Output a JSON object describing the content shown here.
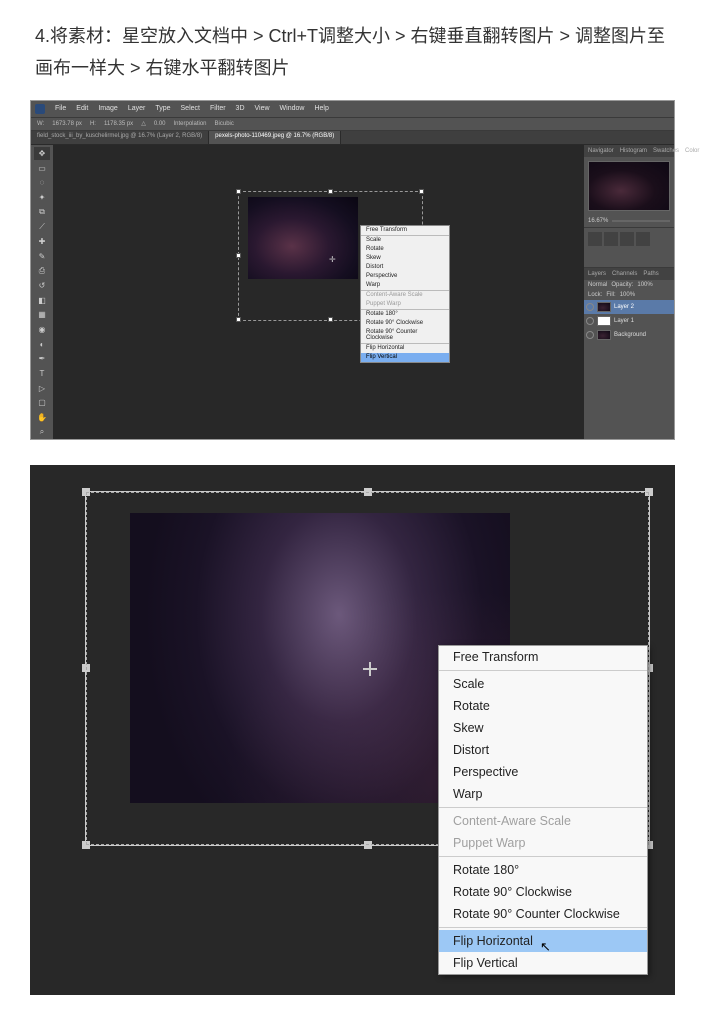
{
  "instruction_text": "4.将素材：星空放入文档中 > Ctrl+T调整大小 > 右键垂直翻转图片 > 调整图片至画布一样大 > 右键水平翻转图片",
  "menubar": [
    "File",
    "Edit",
    "Image",
    "Layer",
    "Type",
    "Select",
    "Filter",
    "3D",
    "View",
    "Window",
    "Help"
  ],
  "options_bar": {
    "w": "1673.78 px",
    "h": "1178.35 px",
    "angle": "0.00",
    "interp": "Interpolation",
    "bicubic": "Bicubic"
  },
  "doc_tabs": [
    "field_stock_iii_by_kuschelirmel.jpg @ 16.7% (Layer 2, RGB/8)",
    "pexels-photo-110469.jpeg @ 16.7% (RGB/8)"
  ],
  "active_tab_index": 1,
  "nav_panel": {
    "tabs": [
      "Navigator",
      "Histogram",
      "Swatches",
      "Color"
    ],
    "zoom": "16.67%"
  },
  "layers_panel": {
    "tabs": [
      "Layers",
      "Channels",
      "Paths"
    ],
    "mode": "Normal",
    "opacity": "100%",
    "fill": "100%",
    "lock": "Lock:",
    "layers": [
      {
        "name": "Layer 2",
        "thumb": "sky",
        "selected": true
      },
      {
        "name": "Layer 1",
        "thumb": "white",
        "selected": false
      },
      {
        "name": "Background",
        "thumb": "sky",
        "selected": false
      }
    ]
  },
  "context_menu_small": {
    "items": [
      {
        "t": "Free Transform",
        "e": true
      },
      {
        "hr": true
      },
      {
        "t": "Scale",
        "e": true
      },
      {
        "t": "Rotate",
        "e": true
      },
      {
        "t": "Skew",
        "e": true
      },
      {
        "t": "Distort",
        "e": true
      },
      {
        "t": "Perspective",
        "e": true
      },
      {
        "t": "Warp",
        "e": true
      },
      {
        "hr": true
      },
      {
        "t": "Content-Aware Scale",
        "e": false
      },
      {
        "t": "Puppet Warp",
        "e": false
      },
      {
        "hr": true
      },
      {
        "t": "Rotate 180°",
        "e": true
      },
      {
        "t": "Rotate 90° Clockwise",
        "e": true
      },
      {
        "t": "Rotate 90° Counter Clockwise",
        "e": true
      },
      {
        "hr": true
      },
      {
        "t": "Flip Horizontal",
        "e": true
      },
      {
        "t": "Flip Vertical",
        "e": true,
        "hl": true
      }
    ]
  },
  "context_menu_large": {
    "items": [
      {
        "t": "Free Transform",
        "e": true
      },
      {
        "hr": true
      },
      {
        "t": "Scale",
        "e": true
      },
      {
        "t": "Rotate",
        "e": true
      },
      {
        "t": "Skew",
        "e": true
      },
      {
        "t": "Distort",
        "e": true
      },
      {
        "t": "Perspective",
        "e": true
      },
      {
        "t": "Warp",
        "e": true
      },
      {
        "hr": true
      },
      {
        "t": "Content-Aware Scale",
        "e": false
      },
      {
        "t": "Puppet Warp",
        "e": false
      },
      {
        "hr": true
      },
      {
        "t": "Rotate 180°",
        "e": true
      },
      {
        "t": "Rotate 90° Clockwise",
        "e": true
      },
      {
        "t": "Rotate 90° Counter Clockwise",
        "e": true
      },
      {
        "hr": true
      },
      {
        "t": "Flip Horizontal",
        "e": true,
        "hl": true
      },
      {
        "t": "Flip Vertical",
        "e": true
      }
    ]
  },
  "cursor_glyph": "↖"
}
